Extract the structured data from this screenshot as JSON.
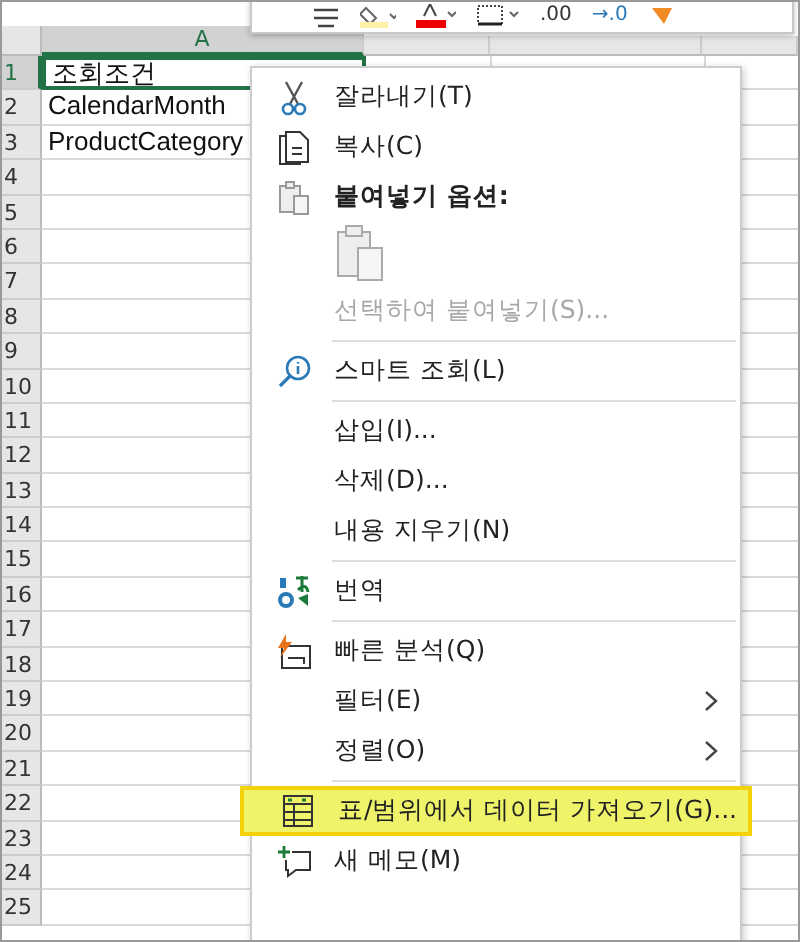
{
  "toolbar": {
    "texts": [
      ".00",
      "→.0"
    ]
  },
  "columns": [
    {
      "label": "A",
      "selected": true
    }
  ],
  "rows": [
    {
      "label": "1",
      "selected": true,
      "cells": [
        "조회조건"
      ]
    },
    {
      "label": "2",
      "selected": false,
      "cells": [
        "CalendarMonth"
      ]
    },
    {
      "label": "3",
      "selected": false,
      "cells": [
        "ProductCategory"
      ]
    },
    {
      "label": "4",
      "selected": false
    },
    {
      "label": "5",
      "selected": false
    },
    {
      "label": "6",
      "selected": false
    },
    {
      "label": "7",
      "selected": false
    },
    {
      "label": "8",
      "selected": false
    },
    {
      "label": "9",
      "selected": false
    },
    {
      "label": "10",
      "selected": false
    },
    {
      "label": "11",
      "selected": false
    },
    {
      "label": "12",
      "selected": false
    },
    {
      "label": "13",
      "selected": false
    },
    {
      "label": "14",
      "selected": false
    },
    {
      "label": "15",
      "selected": false
    },
    {
      "label": "16",
      "selected": false
    },
    {
      "label": "17",
      "selected": false
    },
    {
      "label": "18",
      "selected": false
    },
    {
      "label": "19",
      "selected": false
    },
    {
      "label": "20",
      "selected": false
    },
    {
      "label": "21",
      "selected": false
    },
    {
      "label": "22",
      "selected": false
    },
    {
      "label": "23",
      "selected": false
    },
    {
      "label": "24",
      "selected": false
    },
    {
      "label": "25",
      "selected": false
    }
  ],
  "menu": {
    "items": [
      {
        "kind": "item",
        "label": "잘라내기(T)",
        "disabled": false,
        "selected": false,
        "submenu": false
      },
      {
        "kind": "item",
        "label": "복사(C)",
        "disabled": false,
        "selected": false,
        "submenu": false
      },
      {
        "kind": "header",
        "label": "붙여넣기 옵션:"
      },
      {
        "kind": "paste-options"
      },
      {
        "kind": "item",
        "label": "선택하여 붙여넣기(S)...",
        "disabled": true,
        "selected": false,
        "submenu": false
      },
      {
        "kind": "separator"
      },
      {
        "kind": "item",
        "label": "스마트 조회(L)",
        "disabled": false,
        "selected": false,
        "submenu": false
      },
      {
        "kind": "separator"
      },
      {
        "kind": "item",
        "label": "삽입(I)...",
        "disabled": false,
        "selected": false,
        "submenu": false
      },
      {
        "kind": "item",
        "label": "삭제(D)...",
        "disabled": false,
        "selected": false,
        "submenu": false
      },
      {
        "kind": "item",
        "label": "내용 지우기(N)",
        "disabled": false,
        "selected": false,
        "submenu": false
      },
      {
        "kind": "separator"
      },
      {
        "kind": "item",
        "label": "번역",
        "disabled": false,
        "selected": false,
        "submenu": false
      },
      {
        "kind": "separator"
      },
      {
        "kind": "item",
        "label": "빠른 분석(Q)",
        "disabled": false,
        "selected": false,
        "submenu": false
      },
      {
        "kind": "item",
        "label": "필터(E)",
        "disabled": false,
        "selected": false,
        "submenu": true
      },
      {
        "kind": "item",
        "label": "정렬(O)",
        "disabled": false,
        "selected": false,
        "submenu": true
      },
      {
        "kind": "separator"
      },
      {
        "kind": "item",
        "label": "표/범위에서 데이터 가져오기(G)...",
        "disabled": false,
        "selected": true,
        "submenu": false
      },
      {
        "kind": "item",
        "label": "새 메모(M)",
        "disabled": false,
        "selected": false,
        "submenu": false
      }
    ]
  }
}
